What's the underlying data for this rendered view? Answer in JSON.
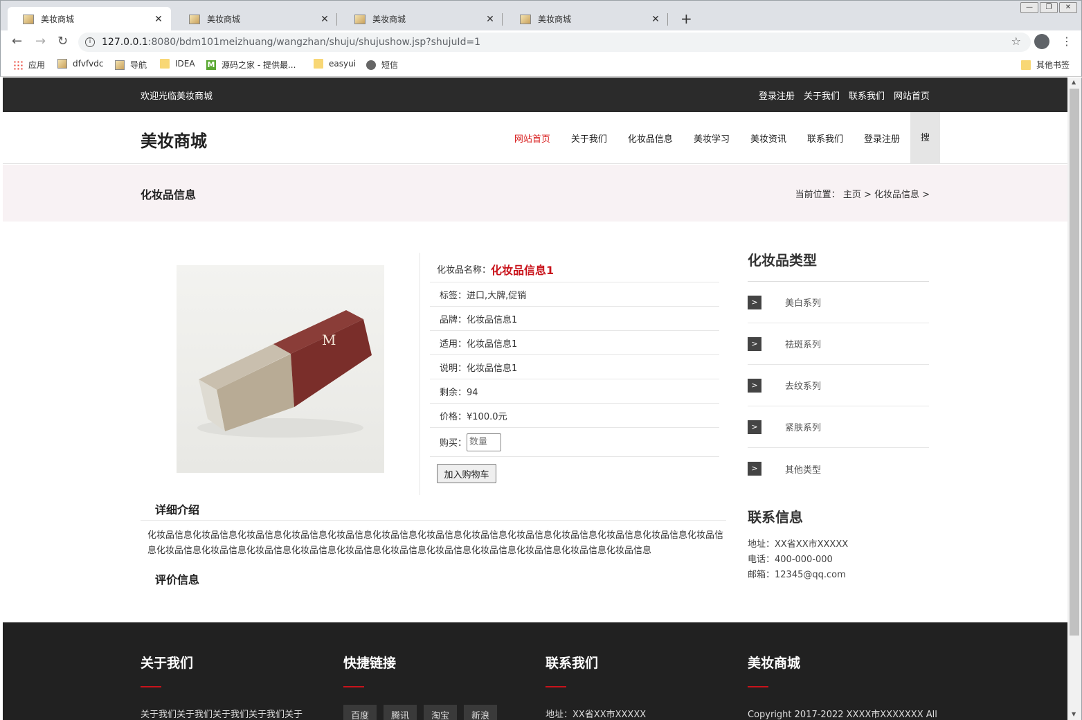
{
  "browser": {
    "tabs": [
      {
        "title": "美妆商城",
        "active": true
      },
      {
        "title": "美妆商城",
        "active": false
      },
      {
        "title": "美妆商城",
        "active": false
      },
      {
        "title": "美妆商城",
        "active": false
      }
    ],
    "url_host": "127.0.0.1",
    "url_path": ":8080/bdm101meizhuang/wangzhan/shuju/shujushow.jsp?shujuId=1",
    "bookmarks": [
      "应用",
      "dfvfvdc",
      "导航",
      "IDEA",
      "源码之家 - 提供最...",
      "easyui",
      "短信"
    ],
    "other_bookmarks": "其他书签"
  },
  "topbar": {
    "welcome": "欢迎光临美妆商城",
    "links": [
      "登录注册",
      "关于我们",
      "联系我们",
      "网站首页"
    ]
  },
  "header": {
    "logo": "美妆商城",
    "nav": [
      "网站首页",
      "关于我们",
      "化妆品信息",
      "美妆学习",
      "美妆资讯",
      "联系我们",
      "登录注册"
    ],
    "active_nav": "网站首页",
    "search_label": "搜"
  },
  "banner": {
    "title": "化妆品信息",
    "crumb_label": "当前位置：",
    "crumb": "主页 > 化妆品信息 >"
  },
  "product": {
    "name_label": "化妆品名称：",
    "name": "化妆品信息1",
    "tags": "标签：进口,大牌,促销",
    "brand": "品牌：化妆品信息1",
    "suitable": "适用：化妆品信息1",
    "note": "说明：化妆品信息1",
    "stock": "剩余：94",
    "price": "价格：¥100.0元",
    "buy_label": "购买：",
    "qty_placeholder": "数量",
    "cart_button": "加入购物车",
    "image_icon": "cosmetic-box-image",
    "box_letter": "M"
  },
  "detail": {
    "title": "详细介绍",
    "text": "化妆品信息化妆品信息化妆品信息化妆品信息化妆品信息化妆品信息化妆品信息化妆品信息化妆品信息化妆品信息化妆品信息化妆品信息化妆品信息化妆品信息化妆品信息化妆品信息化妆品信息化妆品信息化妆品信息化妆品信息化妆品信息化妆品信息化妆品信息化妆品信息",
    "review_title": "评价信息"
  },
  "sidebar": {
    "title": "化妆品类型",
    "categories": [
      "美白系列",
      "祛斑系列",
      "去纹系列",
      "紧肤系列",
      "其他类型"
    ],
    "contact_title": "联系信息",
    "address": "地址：XX省XX市XXXXX",
    "phone": "电话：400-000-000",
    "email": "邮箱：12345@qq.com"
  },
  "footer": {
    "about_title": "关于我们",
    "about_text": "关于我们关于我们关于我们关于我们关于",
    "links_title": "快捷链接",
    "links": [
      "百度",
      "腾讯",
      "淘宝",
      "新浪"
    ],
    "contact_title": "联系我们",
    "contact_text": "地址：XX省XX市XXXXX",
    "brand_title": "美妆商城",
    "copyright": "Copyright 2017-2022 XXXX市XXXXXXX All"
  },
  "colors": {
    "accent_red": "#d81e1e",
    "dark_bar": "#2b2b2b",
    "footer_bg": "#212121",
    "banner_bg": "#f8f2f4"
  }
}
